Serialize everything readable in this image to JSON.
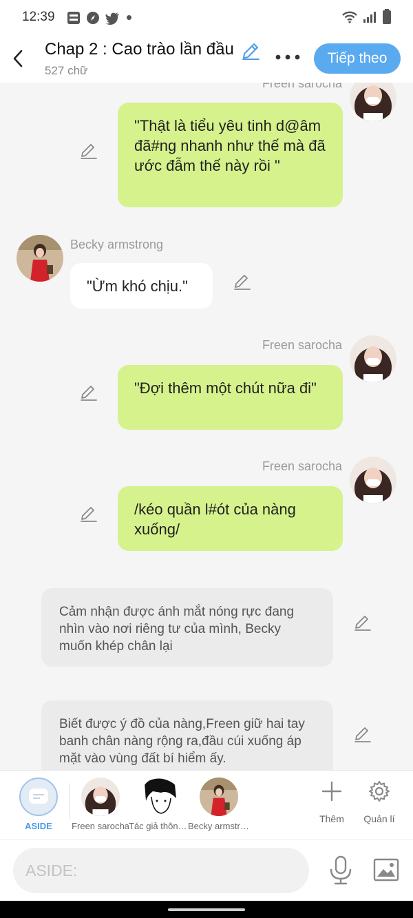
{
  "status_bar": {
    "time": "12:39",
    "left_icons": [
      "bao-moi-icon",
      "compass-icon",
      "twitter-icon",
      "dot-icon"
    ],
    "right_icons": [
      "wifi-icon",
      "signal-icon",
      "battery-icon"
    ]
  },
  "header": {
    "title": "Chap 2 : Cao trào lần đầu",
    "word_count": "527 chữ",
    "next_label": "Tiếp theo",
    "accent": "#5aaaf0"
  },
  "messages": [
    {
      "type": "green",
      "side": "right",
      "sender": "Freen sarocha",
      "text": "\"Thật là tiểu yêu tinh d@âm đã#ng nhanh như thế mà đã ước đẫm thế này rồi \""
    },
    {
      "type": "white",
      "side": "left",
      "sender": "Becky armstrong",
      "text": "\"Ừm khó chịu.\""
    },
    {
      "type": "green",
      "side": "right",
      "sender": "Freen sarocha",
      "text": "\"Đợi thêm một chút nữa đi\""
    },
    {
      "type": "green",
      "side": "right",
      "sender": "Freen sarocha",
      "text": "/kéo quần l#ót của nàng xuống/"
    },
    {
      "type": "aside",
      "side": "center",
      "text": "Cảm nhận được ánh mắt nóng rực đang nhìn vào nơi riêng tư của mình, Becky muốn khép chân lại"
    },
    {
      "type": "aside",
      "side": "center",
      "text": "Biết được ý đồ của nàng,Freen giữ hai tay banh chân nàng rộng ra,đầu cúi xuống áp mặt vào vùng đất bí hiểm ấy."
    }
  ],
  "characters": [
    {
      "label": "ASIDE",
      "selected": true
    },
    {
      "label": "Freen sarocha"
    },
    {
      "label": "Tác giả thông báo"
    },
    {
      "label": "Becky armstrong"
    }
  ],
  "tools": {
    "add_label": "Thêm",
    "manage_label": "Quản lí"
  },
  "composer": {
    "placeholder": "ASIDE:"
  },
  "colors": {
    "green_bubble": "#d6f28c",
    "aside_bubble": "#ebebeb",
    "background": "#f5f5f5"
  }
}
